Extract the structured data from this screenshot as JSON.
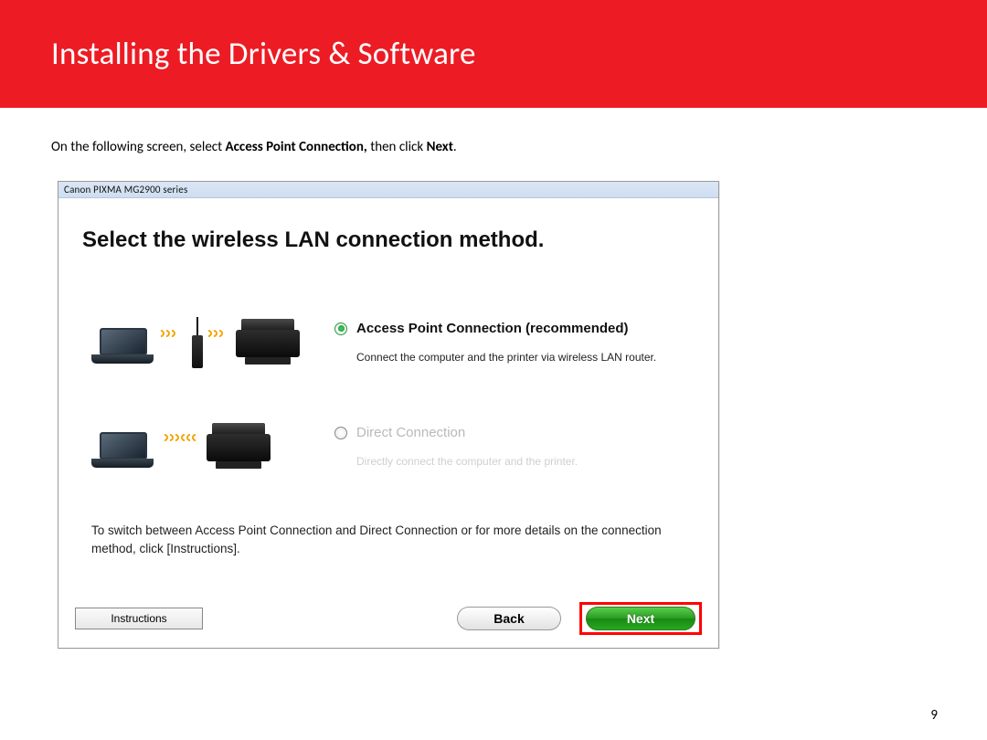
{
  "banner": {
    "title": "Installing  the Drivers & Software"
  },
  "instruction": {
    "pre": "On the following screen, select ",
    "bold1": "Access Point Connection, ",
    "mid": "then click ",
    "bold2": "Next",
    "post": "."
  },
  "dialog": {
    "titlebar": "Canon PIXMA MG2900 series",
    "heading": "Select the wireless LAN connection method.",
    "option1": {
      "label": "Access Point Connection (recommended)",
      "desc": "Connect the computer and the printer via wireless LAN router."
    },
    "option2": {
      "label": "Direct Connection",
      "desc": "Directly connect the computer and the printer."
    },
    "note": "To switch between Access Point Connection and Direct Connection or for more details on the connection method, click [Instructions].",
    "buttons": {
      "instructions": "Instructions",
      "back": "Back",
      "next": "Next"
    }
  },
  "page_number": "9"
}
